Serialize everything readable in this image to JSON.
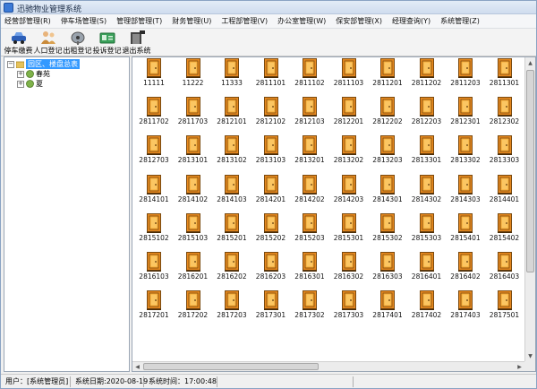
{
  "window": {
    "title": "迅驰物业管理系统"
  },
  "menu": [
    "经营部管理(R)",
    "停车场管理(S)",
    "管理部管理(T)",
    "财务管理(U)",
    "工程部管理(V)",
    "办公室管理(W)",
    "保安部管理(X)",
    "经理查询(Y)",
    "系统管理(Z)"
  ],
  "toolbar": [
    {
      "label": "停车缴费",
      "icon": "car-icon"
    },
    {
      "label": "人口登记",
      "icon": "people-icon"
    },
    {
      "label": "出租登记",
      "icon": "satellite-icon"
    },
    {
      "label": "投诉登记",
      "icon": "id-card-icon"
    },
    {
      "label": "退出系统",
      "icon": "exit-icon"
    }
  ],
  "tree": {
    "root": "园区、楼盘总表",
    "children": [
      "春苑",
      "夏"
    ]
  },
  "rooms": [
    [
      "11111",
      "11222",
      "11333",
      "2811101",
      "2811102",
      "2811103",
      "2811201",
      "2811202",
      "2811203",
      "2811301"
    ],
    [
      "2811702",
      "2811703",
      "2812101",
      "2812102",
      "2812103",
      "2812201",
      "2812202",
      "2812203",
      "2812301",
      "2812302"
    ],
    [
      "2812703",
      "2813101",
      "2813102",
      "2813103",
      "2813201",
      "2813202",
      "2813203",
      "2813301",
      "2813302",
      "2813303"
    ],
    [
      "2814101",
      "2814102",
      "2814103",
      "2814201",
      "2814202",
      "2814203",
      "2814301",
      "2814302",
      "2814303",
      "2814401"
    ],
    [
      "2815102",
      "2815103",
      "2815201",
      "2815202",
      "2815203",
      "2815301",
      "2815302",
      "2815303",
      "2815401",
      "2815402"
    ],
    [
      "2816103",
      "2816201",
      "2816202",
      "2816203",
      "2816301",
      "2816302",
      "2816303",
      "2816401",
      "2816402",
      "2816403"
    ],
    [
      "2817201",
      "2817202",
      "2817203",
      "2817301",
      "2817302",
      "2817303",
      "2817401",
      "2817402",
      "2817403",
      "2817501"
    ]
  ],
  "status": {
    "user": "用户：[系统管理员]",
    "date": "系统日期:2020-08-19",
    "time": "系统时间：17:00:48"
  },
  "colors": {
    "door": "#e8891e",
    "door_dark": "#7a4a10",
    "selection": "#3399ff"
  }
}
